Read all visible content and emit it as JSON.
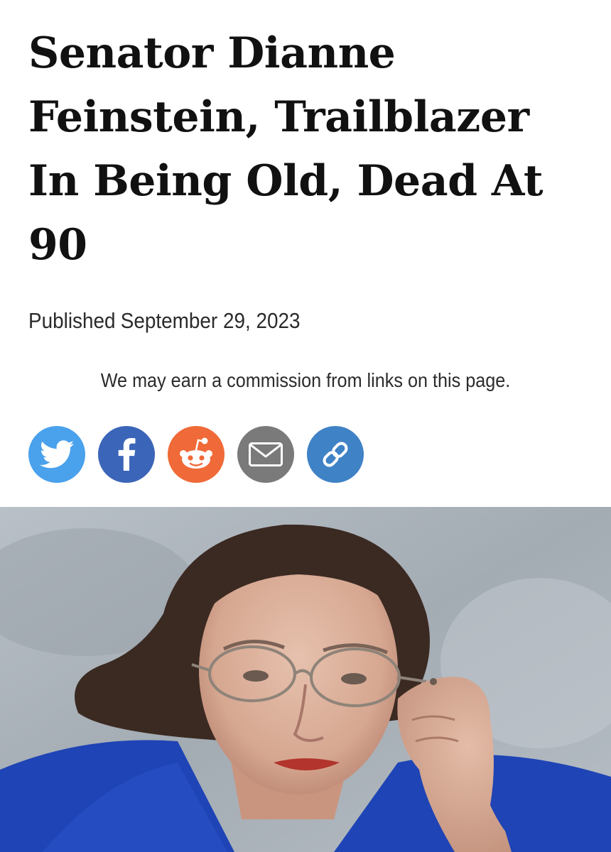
{
  "article": {
    "headline": "Senator Dianne Feinstein, Trailblazer In Being Old, Dead At 90",
    "published_label": "Published",
    "published_date": "September 29, 2023",
    "disclosure": "We may earn a commission from links on this page."
  },
  "share": {
    "buttons": [
      {
        "name": "twitter",
        "icon": "twitter-bird-icon",
        "color": "#4aa1ec"
      },
      {
        "name": "facebook",
        "icon": "facebook-f-icon",
        "color": "#3b65b8"
      },
      {
        "name": "reddit",
        "icon": "reddit-alien-icon",
        "color": "#ef6a38"
      },
      {
        "name": "email",
        "icon": "envelope-icon",
        "color": "#7a7a7a"
      },
      {
        "name": "copy-link",
        "icon": "link-icon",
        "color": "#3f82c6"
      }
    ]
  },
  "hero_image": {
    "subject": "elderly-woman-portrait",
    "colors": {
      "background": "#aab1b8",
      "jacket": "#1f44b5",
      "hair": "#3b2a22"
    }
  }
}
